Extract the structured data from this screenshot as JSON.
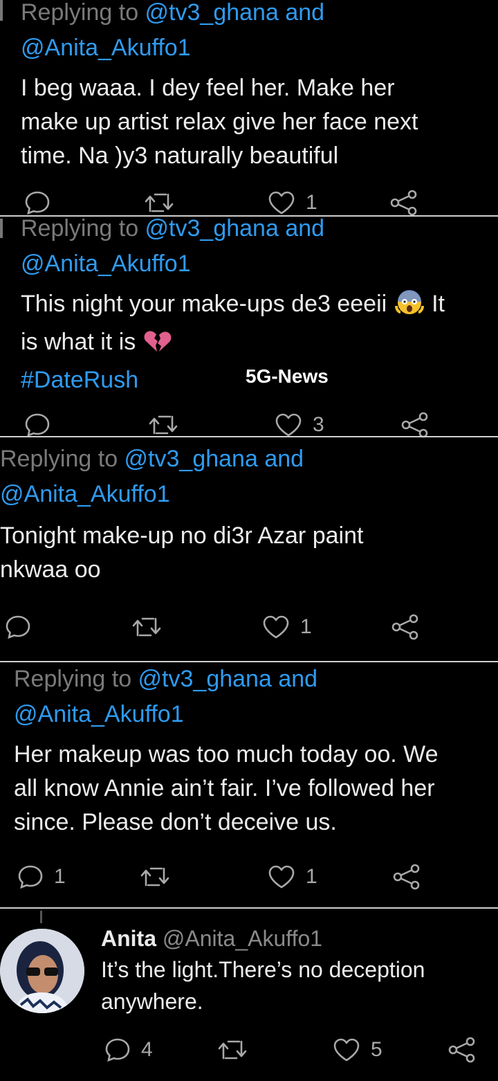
{
  "tweets": [
    {
      "reply_prefix": "Replying to ",
      "reply_handle1": "@tv3_ghana and",
      "reply_handle2": "@Anita_Akuffo1",
      "lines": [
        "I beg waaa. I dey feel her. Make her",
        "make up artist relax give her face next",
        "time. Na )y3 naturally beautiful"
      ],
      "counts": {
        "reply": "",
        "retweet": "",
        "like": "1"
      }
    },
    {
      "reply_prefix": "Replying to ",
      "reply_handle1": "@tv3_ghana and",
      "reply_handle2": "@Anita_Akuffo1",
      "line1": "This night your make-ups de3 eeeii",
      "line1_tail": "It",
      "line2": "is what it is",
      "hashtag": "#DateRush",
      "counts": {
        "reply": "",
        "retweet": "",
        "like": "3"
      }
    },
    {
      "reply_prefix": "Replying to ",
      "reply_handle1": "@tv3_ghana and",
      "reply_handle2": "@Anita_Akuffo1",
      "lines": [
        "Tonight make-up no di3r Azar paint",
        "nkwaa oo"
      ],
      "counts": {
        "reply": "",
        "retweet": "",
        "like": "1"
      }
    },
    {
      "reply_prefix": "Replying to ",
      "reply_handle1": "@tv3_ghana and",
      "reply_handle2": "@Anita_Akuffo1",
      "lines": [
        "Her makeup was too much today oo. We",
        "all know Annie ain’t fair. I’ve followed her",
        "since. Please don’t deceive us."
      ],
      "counts": {
        "reply": "1",
        "retweet": "",
        "like": "1"
      }
    }
  ],
  "author_reply": {
    "name": "Anita",
    "handle": "@Anita_Akuffo1",
    "lines": [
      "It’s the light.There’s no deception",
      "anywhere."
    ],
    "counts": {
      "reply": "4",
      "retweet": "",
      "like": "5"
    }
  },
  "watermark": "5G-News",
  "colors": {
    "link": "#2f9bf0",
    "muted": "#7a7a7a",
    "background": "#000000"
  },
  "icons": [
    "reply-icon",
    "retweet-icon",
    "like-icon",
    "share-icon",
    "fearful-face-emoji",
    "broken-heart-emoji"
  ]
}
